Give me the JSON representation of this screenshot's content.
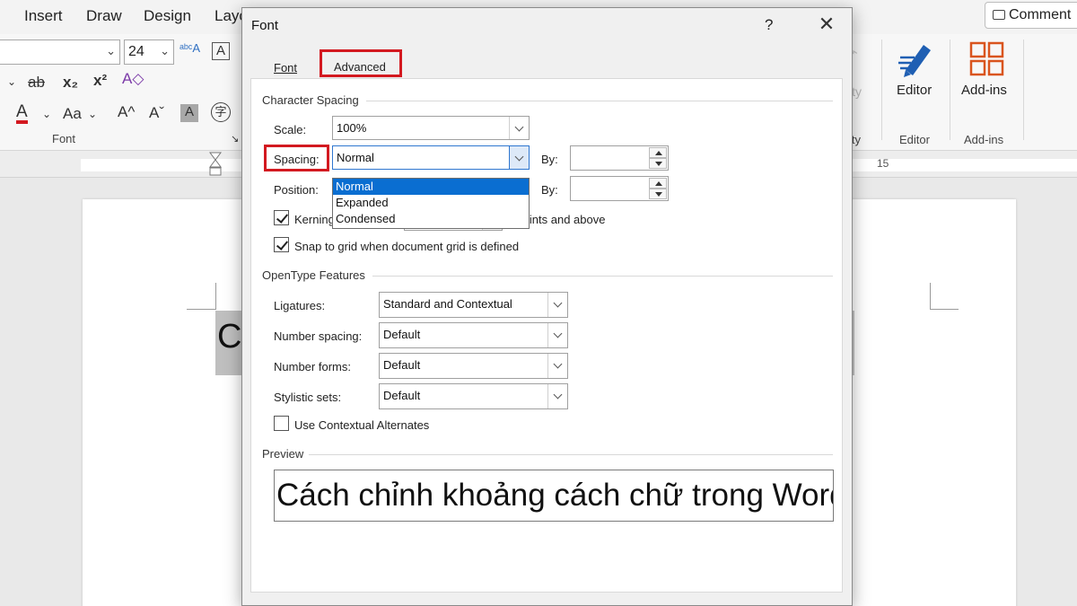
{
  "menubar": {
    "items": [
      "Insert",
      "Draw",
      "Design",
      "Layo"
    ],
    "comments_label": "Comment"
  },
  "ribbon": {
    "font_name": "",
    "font_size": "24",
    "font_group_label": "Font",
    "editor_label": "Editor",
    "editor_group_label": "Editor",
    "addins_label": "Add-ins",
    "addins_group_label": "Add-ins",
    "sensitivity_partial": "ity",
    "sensitivity_group_partial": "ity",
    "glyphs": {
      "clear_format": "A",
      "strike": "ab",
      "subscript": "x₂",
      "superscript": "x²",
      "font_color": "A",
      "change_case": "Aa",
      "grow": "A^",
      "shrink": "Aˇ",
      "char_shading": "A",
      "enclose": "字"
    }
  },
  "ruler": {
    "mark": "15"
  },
  "document": {
    "selected_text": "Cá"
  },
  "dialog": {
    "title": "Font",
    "help": "?",
    "tabs": {
      "font": "Font",
      "advanced": "Advanced"
    },
    "character_spacing": {
      "section": "Character Spacing",
      "scale_label": "Scale:",
      "scale_value": "100%",
      "spacing_label": "Spacing:",
      "spacing_value": "Normal",
      "spacing_options": [
        "Normal",
        "Expanded",
        "Condensed"
      ],
      "by_label": "By:",
      "position_label": "Position:",
      "position_by_label": "By:",
      "kerning_label": "Kerning for fonts:",
      "kerning_suffix": "Points and above",
      "kerning_checked": true,
      "snap_label": "Snap to grid when document grid is defined",
      "snap_checked": true
    },
    "opentype": {
      "section": "OpenType Features",
      "ligatures_label": "Ligatures:",
      "ligatures_value": "Standard and Contextual",
      "number_spacing_label": "Number spacing:",
      "number_spacing_value": "Default",
      "number_forms_label": "Number forms:",
      "number_forms_value": "Default",
      "stylistic_sets_label": "Stylistic sets:",
      "stylistic_sets_value": "Default",
      "contextual_label": "Use Contextual Alternates",
      "contextual_checked": false
    },
    "preview": {
      "section": "Preview",
      "text": "Cách chỉnh khoảng cách chữ trong Word"
    }
  },
  "colors": {
    "highlight_red": "#d31920",
    "selection_blue": "#0a6ed1",
    "editor_blue": "#1f5fb3",
    "addins_orange": "#d9541e"
  }
}
